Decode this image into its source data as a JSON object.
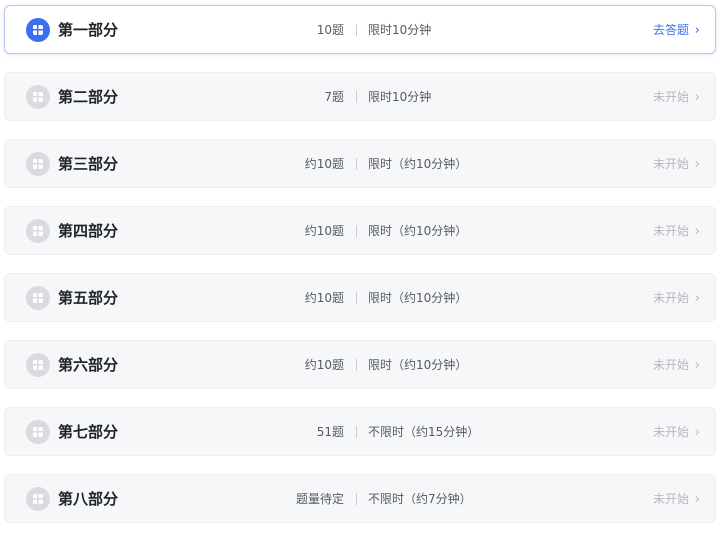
{
  "sections": [
    {
      "title": "第一部分",
      "count": "10题",
      "time": "限时10分钟",
      "status": "去答题",
      "chevron": "›",
      "icon": "list-icon",
      "active": true
    },
    {
      "title": "第二部分",
      "count": "7题",
      "time": "限时10分钟",
      "status": "未开始",
      "chevron": "›",
      "icon": "list-icon",
      "active": false
    },
    {
      "title": "第三部分",
      "count": "约10题",
      "time": "限时（约10分钟）",
      "status": "未开始",
      "chevron": "›",
      "icon": "list-icon",
      "active": false
    },
    {
      "title": "第四部分",
      "count": "约10题",
      "time": "限时（约10分钟）",
      "status": "未开始",
      "chevron": "›",
      "icon": "list-icon",
      "active": false
    },
    {
      "title": "第五部分",
      "count": "约10题",
      "time": "限时（约10分钟）",
      "status": "未开始",
      "chevron": "›",
      "icon": "list-icon",
      "active": false
    },
    {
      "title": "第六部分",
      "count": "约10题",
      "time": "限时（约10分钟）",
      "status": "未开始",
      "chevron": "›",
      "icon": "list-icon",
      "active": false
    },
    {
      "title": "第七部分",
      "count": "51题",
      "time": "不限时（约15分钟）",
      "status": "未开始",
      "chevron": "›",
      "icon": "list-icon",
      "active": false
    },
    {
      "title": "第八部分",
      "count": "题量待定",
      "time": "不限时（约7分钟）",
      "status": "未开始",
      "chevron": "›",
      "icon": "list-icon",
      "active": false
    }
  ],
  "colors": {
    "accent": "#3b6ff0",
    "inactive_text": "#b5b8bd",
    "row_background": "#f6f7f9"
  }
}
